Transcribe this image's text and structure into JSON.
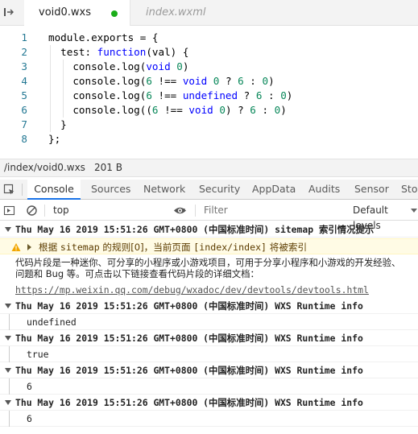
{
  "editor": {
    "tabs": [
      {
        "label": "void0.wxs",
        "active": true,
        "modified": true
      },
      {
        "label": "index.wxml",
        "active": false
      }
    ],
    "lines": [
      {
        "num": "1",
        "tokens": [
          {
            "t": "module.exports = {",
            "c": ""
          }
        ]
      },
      {
        "num": "2",
        "tokens": [
          {
            "t": "  test: ",
            "c": ""
          },
          {
            "t": "function",
            "c": "kw"
          },
          {
            "t": "(val) {",
            "c": ""
          }
        ]
      },
      {
        "num": "3",
        "tokens": [
          {
            "t": "    console.log(",
            "c": ""
          },
          {
            "t": "void",
            "c": "kw"
          },
          {
            "t": " ",
            "c": ""
          },
          {
            "t": "0",
            "c": "num"
          },
          {
            "t": ")",
            "c": ""
          }
        ]
      },
      {
        "num": "4",
        "tokens": [
          {
            "t": "    console.log(",
            "c": ""
          },
          {
            "t": "6",
            "c": "num"
          },
          {
            "t": " !== ",
            "c": ""
          },
          {
            "t": "void",
            "c": "kw"
          },
          {
            "t": " ",
            "c": ""
          },
          {
            "t": "0",
            "c": "num"
          },
          {
            "t": " ? ",
            "c": ""
          },
          {
            "t": "6",
            "c": "num"
          },
          {
            "t": " : ",
            "c": ""
          },
          {
            "t": "0",
            "c": "num"
          },
          {
            "t": ")",
            "c": ""
          }
        ]
      },
      {
        "num": "5",
        "tokens": [
          {
            "t": "    console.log(",
            "c": ""
          },
          {
            "t": "6",
            "c": "num"
          },
          {
            "t": " !== ",
            "c": ""
          },
          {
            "t": "undefined",
            "c": "kw"
          },
          {
            "t": " ? ",
            "c": ""
          },
          {
            "t": "6",
            "c": "num"
          },
          {
            "t": " : ",
            "c": ""
          },
          {
            "t": "0",
            "c": "num"
          },
          {
            "t": ")",
            "c": ""
          }
        ]
      },
      {
        "num": "6",
        "tokens": [
          {
            "t": "    console.log((",
            "c": ""
          },
          {
            "t": "6",
            "c": "num"
          },
          {
            "t": " !== ",
            "c": ""
          },
          {
            "t": "void",
            "c": "kw"
          },
          {
            "t": " ",
            "c": ""
          },
          {
            "t": "0",
            "c": "num"
          },
          {
            "t": ") ? ",
            "c": ""
          },
          {
            "t": "6",
            "c": "num"
          },
          {
            "t": " : ",
            "c": ""
          },
          {
            "t": "0",
            "c": "num"
          },
          {
            "t": ")",
            "c": ""
          }
        ]
      },
      {
        "num": "7",
        "tokens": [
          {
            "t": "  }",
            "c": ""
          }
        ]
      },
      {
        "num": "8",
        "tokens": [
          {
            "t": "};",
            "c": ""
          }
        ]
      }
    ]
  },
  "status": {
    "path": "/index/void0.wxs",
    "size": "201 B"
  },
  "devtools": {
    "tabs": [
      "Console",
      "Sources",
      "Network",
      "Security",
      "AppData",
      "Audits",
      "Sensor",
      "Stor"
    ],
    "active_tab": "Console"
  },
  "console_toolbar": {
    "context": "top",
    "filter_placeholder": "Filter",
    "levels": "Default levels"
  },
  "console": {
    "sitemap_header": "Thu May 16 2019 15:51:26 GMT+0800 (中国标准时间) sitemap 索引情况提示",
    "warning_prefix": "根据 ",
    "warning_mono1": "sitemap",
    "warning_mid": " 的规则[0]，当前页面 ",
    "warning_mono2": "[index/index]",
    "warning_suffix": " 将被索引",
    "info_line1": "代码片段是一种迷你、可分享的小程序或小游戏项目，可用于分享小程序和小游戏的开发经验、",
    "info_line2": "问题和 Bug 等。可点击以下链接查看代码片段的详细文档：",
    "info_link": "https://mp.weixin.qq.com/debug/wxadoc/dev/devtools/devtools.html",
    "groups": [
      {
        "header": "Thu May 16 2019 15:51:26 GMT+0800 (中国标准时间) WXS Runtime info",
        "value": "undefined"
      },
      {
        "header": "Thu May 16 2019 15:51:26 GMT+0800 (中国标准时间) WXS Runtime info",
        "value": "true"
      },
      {
        "header": "Thu May 16 2019 15:51:26 GMT+0800 (中国标准时间) WXS Runtime info",
        "value": "6"
      },
      {
        "header": "Thu May 16 2019 15:51:26 GMT+0800 (中国标准时间) WXS Runtime info",
        "value": "6"
      }
    ]
  },
  "colors": {
    "accent": "#1a73e8",
    "modified_dot": "#1aad19",
    "keyword": "#0000ff",
    "number": "#09885a",
    "line_number": "#237893",
    "warning_bg": "#fffbe5"
  }
}
